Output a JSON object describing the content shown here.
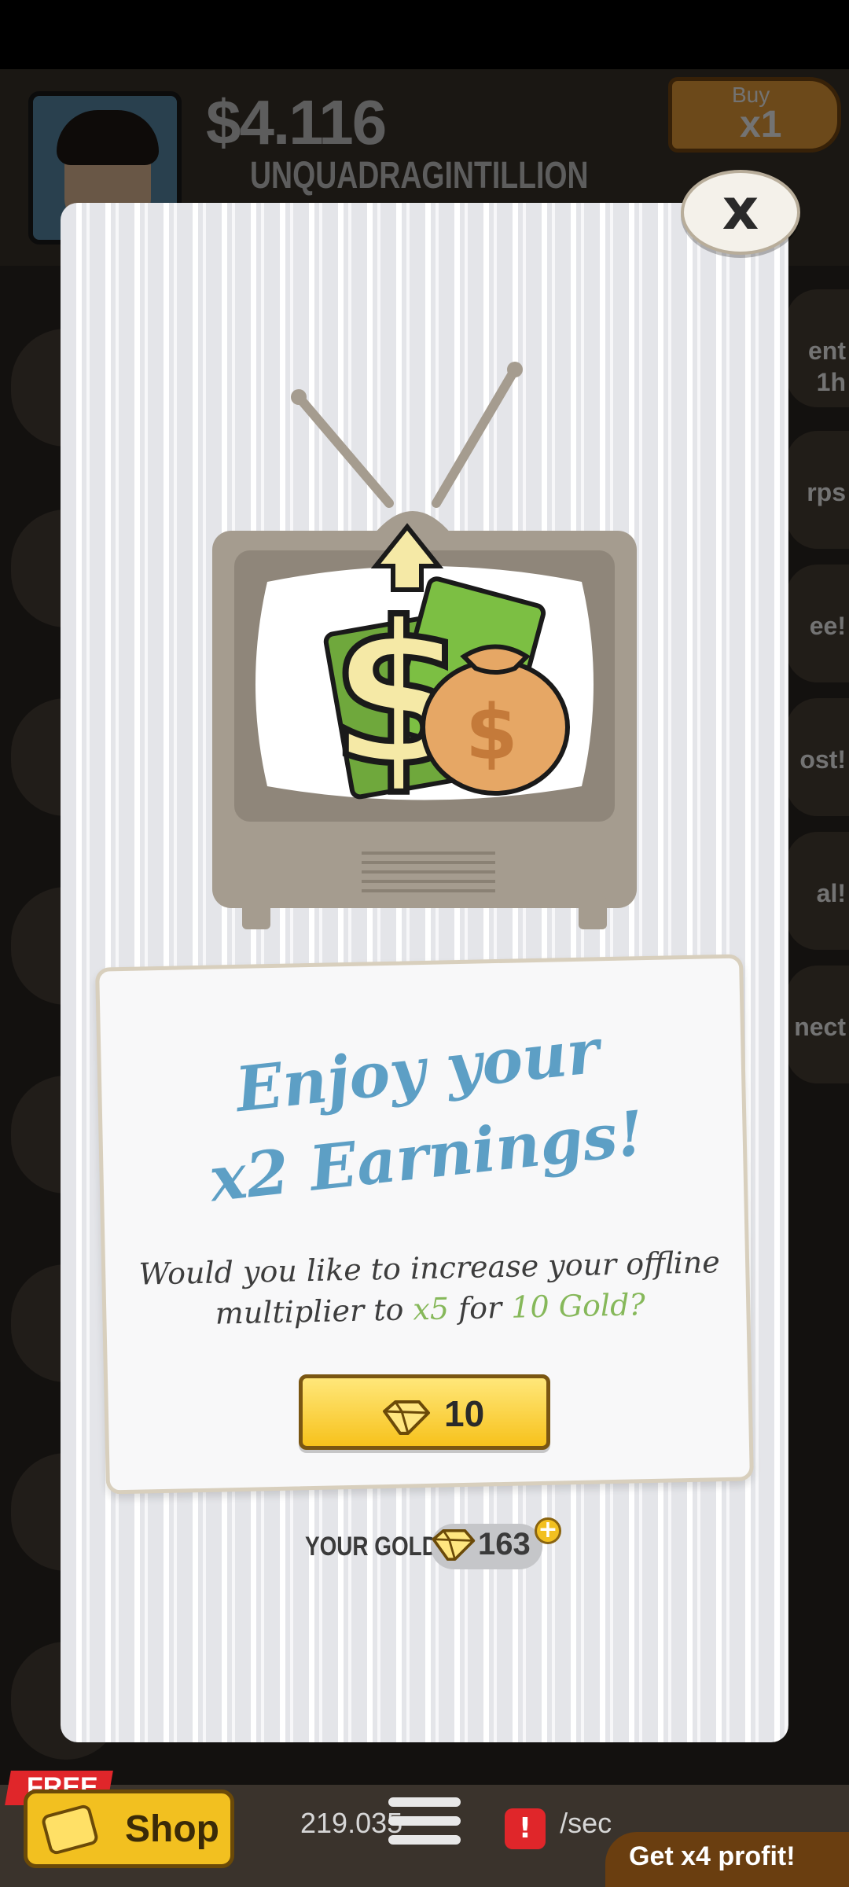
{
  "background": {
    "money": "$4.116",
    "money_unit": "UNQUADRAGINTILLION",
    "buy_label": "Buy",
    "buy_multiplier": "x1",
    "side_buttons": [
      "ent",
      "1h",
      "rps",
      "ee!",
      "ost!",
      "al!",
      "nect"
    ],
    "free_label": "FREE",
    "shop_label": "Shop",
    "rate_text": "219.035",
    "rate_suffix": "/sec",
    "x4_label": "Get x4 profit!",
    "alert_glyph": "!"
  },
  "modal": {
    "close_label": "x",
    "title_line1": "Enjoy your",
    "title_line2": "x2 Earnings!",
    "body_part1": "Would you like to increase your offline multiplier to ",
    "body_multiplier": "x5",
    "body_part2": " for ",
    "body_cost": "10 Gold?",
    "buy_button_value": "10",
    "gold_label": "YOUR GOLD:",
    "gold_value": "163",
    "gold_plus": "+"
  },
  "icons": {
    "tv": "tv-icon",
    "money_bag": "money-bag-icon",
    "gem": "gold-gem-icon",
    "close": "close-icon"
  },
  "colors": {
    "title_blue": "#5d9fc5",
    "accent_green": "#86b85a",
    "button_gold": "#f7c21c",
    "modal_bg": "#e4e5e9"
  }
}
